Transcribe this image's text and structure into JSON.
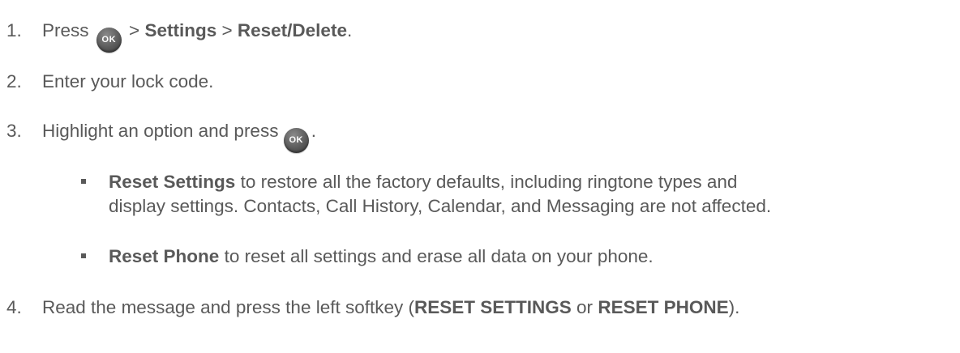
{
  "steps": [
    {
      "number": "1.",
      "press": "Press",
      "ok_label": "OK",
      "gt1": ">",
      "settings": "Settings",
      "gt2": ">",
      "reset_delete": "Reset/Delete",
      "end": "."
    },
    {
      "number": "2.",
      "text": "Enter your lock code."
    },
    {
      "number": "3.",
      "text": "Highlight an option and press",
      "ok_label": "OK",
      "end": "."
    },
    {
      "number": "4.",
      "text": "Read the message and press the left softkey (",
      "reset_settings": "RESET SETTINGS",
      "or": "or",
      "reset_phone": "RESET PHONE",
      "end": ")."
    }
  ],
  "bullets": [
    {
      "bold": "Reset Settings",
      "line1": "to restore all the factory defaults, including ringtone types and",
      "line2": "display settings. Contacts, Call History, Calendar, and Messaging are not affected."
    },
    {
      "bold": "Reset Phone",
      "line1": "to reset all settings and erase all data on your phone."
    }
  ]
}
